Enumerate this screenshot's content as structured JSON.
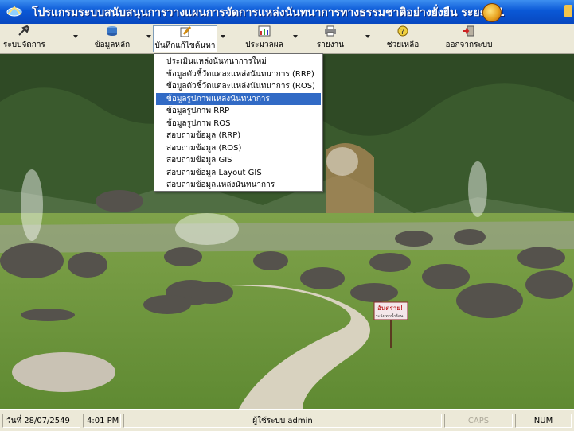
{
  "window": {
    "title": "โปรแกรมระบบสนับสนุนการวางแผนการจัดการแหล่งนันทนาการทางธรรมชาติอย่างยั่งยืน ระยะที่ 1"
  },
  "toolbar": {
    "items": [
      {
        "label": "ระบบจัดการ",
        "icon": "tools-icon"
      },
      {
        "label": "ข้อมูลหลัก",
        "icon": "database-icon"
      },
      {
        "label": "บันทึกแก้ไขค้นหา",
        "icon": "edit-icon"
      },
      {
        "label": "ประมวลผล",
        "icon": "chart-icon"
      },
      {
        "label": "รายงาน",
        "icon": "printer-icon"
      },
      {
        "label": "ช่วยเหลือ",
        "icon": "help-icon"
      },
      {
        "label": "ออกจากระบบ",
        "icon": "exit-icon"
      }
    ]
  },
  "menu": {
    "items": [
      "ประเมินแหล่งนันทนาการใหม่",
      "ข้อมูลตัวชี้วัดแต่ละแหล่งนันทนาการ (RRP)",
      "ข้อมูลตัวชี้วัดแต่ละแหล่งนันทนาการ (ROS)",
      "ข้อมูลรูปภาพแหล่งนันทนาการ",
      "ข้อมูลรูปภาพ RRP",
      "ข้อมูลรูปภาพ ROS",
      "สอบถามข้อมูล (RRP)",
      "สอบถามข้อมูล (ROS)",
      "สอบถามข้อมูล GIS",
      "สอบถามข้อมูล Layout GIS",
      "สอบถามข้อมูลแหล่งนันทนาการ"
    ],
    "selected_index": 3
  },
  "sign": {
    "line1": "อันตราย!",
    "line2": "ระวังเทคน้ำร้อน"
  },
  "statusbar": {
    "date": "วันที่ 28/07/2549",
    "time": "4:01 PM",
    "user": "ผู้ใช้ระบบ admin",
    "caps": "CAPS",
    "num": "NUM"
  },
  "colors": {
    "titlebar": "#0a58d6",
    "menu_highlight": "#316ac5",
    "toolbar_bg": "#ece9d8"
  }
}
